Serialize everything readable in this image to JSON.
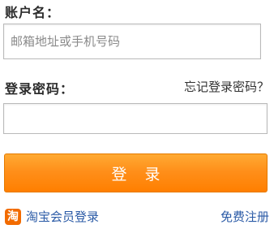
{
  "account": {
    "label": "账户名：",
    "placeholder": "邮箱地址或手机号码"
  },
  "password": {
    "label": "登录密码：",
    "forgot_link": "忘记登录密码？",
    "value": ""
  },
  "login_button": {
    "label": "登录"
  },
  "taobao_login": {
    "icon_char": "淘",
    "label": "淘宝会员登录"
  },
  "register": {
    "label": "免费注册"
  },
  "colors": {
    "button_orange": "#ff8f1a",
    "link_blue": "#2a5aa6",
    "taobao_orange": "#f26b00"
  }
}
